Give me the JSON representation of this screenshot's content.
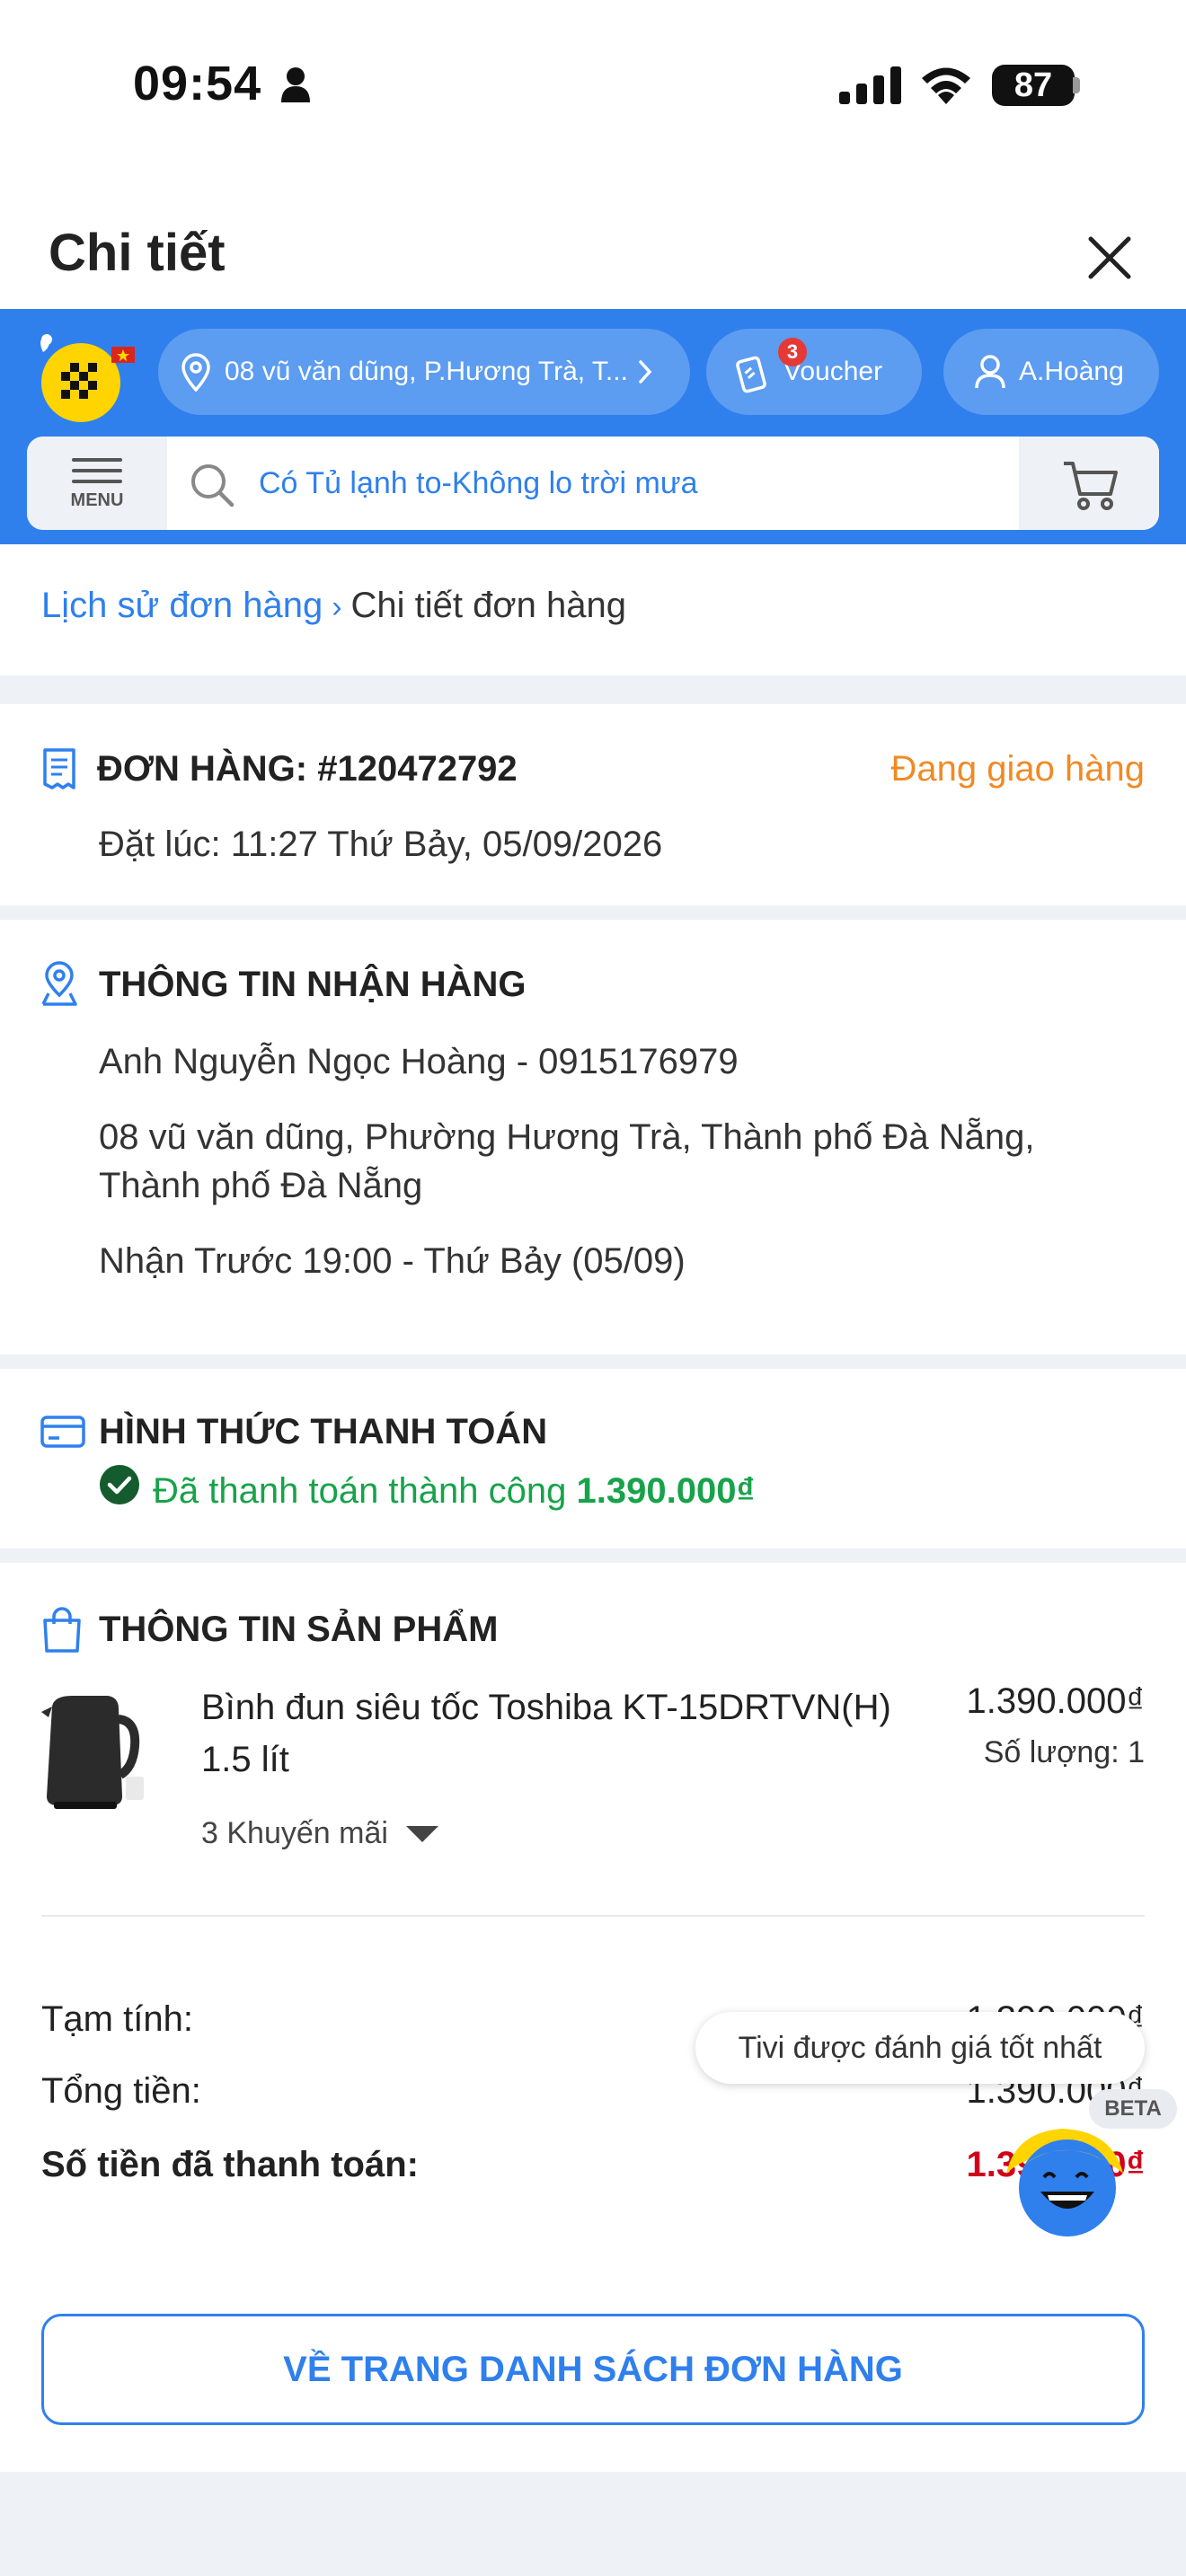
{
  "status_bar": {
    "time": "09:54",
    "battery": "87"
  },
  "sheet": {
    "title": "Chi tiết"
  },
  "header": {
    "address": "08 vũ văn dũng, P.Hương Trà, T...",
    "voucher_label": "Voucher",
    "voucher_count": "3",
    "user_label": "A.Hoàng",
    "menu_label": "MENU",
    "search_placeholder": "Có Tủ lạnh to-Không lo trời mưa"
  },
  "breadcrumb": {
    "parent": "Lịch sử đơn hàng",
    "separator": "›",
    "current": "Chi tiết đơn hàng"
  },
  "order": {
    "title": "ĐƠN HÀNG: #120472792",
    "status": "Đang giao hàng",
    "placed_at": "Đặt lúc: 11:27 Thứ Bảy, 05/09/2026"
  },
  "shipping": {
    "title": "THÔNG TIN NHẬN HÀNG",
    "recipient": "Anh Nguyễn Ngọc Hoàng - 0915176979",
    "address_line1": "08 vũ văn dũng, Phường Hương Trà, Thành phố Đà Nẵng,",
    "address_line2": "Thành phố Đà Nẵng",
    "delivery_time": "Nhận Trước 19:00 - Thứ Bảy (05/09)"
  },
  "payment": {
    "title": "HÌNH THỨC THANH TOÁN",
    "status_text": "Đã thanh toán thành công",
    "amount": "1.390.000₫"
  },
  "product": {
    "title": "THÔNG TIN SẢN PHẨM",
    "name_line1": "Bình đun siêu tốc Toshiba KT-15DRTVN(H)",
    "name_line2": "1.5 lít",
    "price": "1.390.000₫",
    "quantity": "Số lượng: 1",
    "promotions": "3 Khuyến mãi"
  },
  "summary": {
    "subtotal_label": "Tạm tính:",
    "subtotal_value": "1.390.000₫",
    "total_label": "Tổng tiền:",
    "total_value": "1.390.000₫",
    "paid_label": "Số tiền đã thanh toán:",
    "paid_value": "1.390.000₫"
  },
  "actions": {
    "back_button": "VỀ TRANG DANH SÁCH ĐƠN HÀNG"
  },
  "chat": {
    "bubble_text": "Tivi được đánh giá tốt nhất",
    "beta_label": "BETA"
  },
  "colors": {
    "brand_blue": "#2f80ed",
    "status_orange": "#f08a24",
    "success_green": "#17a34a",
    "paid_red": "#d0021b"
  }
}
